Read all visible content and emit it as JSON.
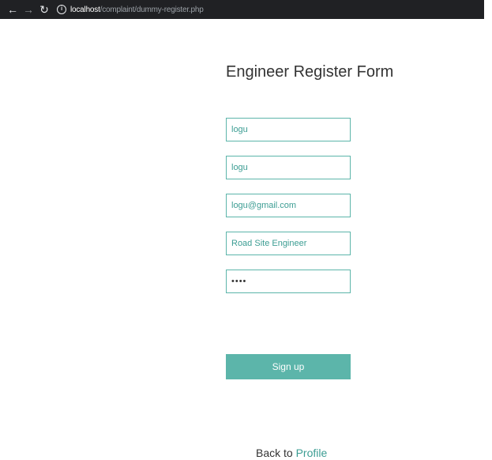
{
  "browser": {
    "back_icon": "back-arrow-icon",
    "forward_icon": "forward-arrow-icon",
    "reload_icon": "reload-icon",
    "info_icon": "info-icon",
    "url_host": "localhost",
    "url_path": "/complaint/dummy-register.php"
  },
  "form": {
    "title": "Engineer Register Form",
    "fields": [
      {
        "value": "logu"
      },
      {
        "value": "logu"
      },
      {
        "value": "logu@gmail.com"
      },
      {
        "value": "Road Site Engineer"
      },
      {
        "value": "••••"
      }
    ],
    "submit_label": "Sign up"
  },
  "footer": {
    "back_prefix": "Back to ",
    "back_link": "Profile"
  },
  "colors": {
    "accent": "#5cb5aa",
    "accent_text": "#3c9d93",
    "browser_bar": "#202124"
  }
}
